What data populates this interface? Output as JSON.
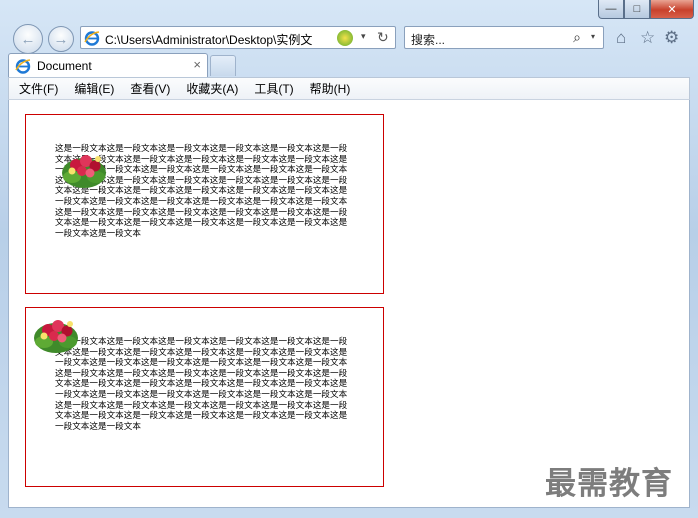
{
  "window": {
    "minimize_glyph": "—",
    "maximize_glyph": "□",
    "close_glyph": "✕"
  },
  "nav": {
    "back_glyph": "←",
    "forward_glyph": "→",
    "address": "C:\\Users\\Administrator\\Desktop\\实例文",
    "refresh_glyph": "↻",
    "dropdown_glyph": "▾"
  },
  "search": {
    "placeholder": "搜索...",
    "icon_glyph": "⌕",
    "dropdown_glyph": "▾"
  },
  "toolbar": {
    "home_glyph": "⌂",
    "favorites_glyph": "☆",
    "settings_glyph": "⚙"
  },
  "tab": {
    "title": "Document",
    "close_glyph": "×"
  },
  "menu": {
    "items": [
      "文件(F)",
      "编辑(E)",
      "查看(V)",
      "收藏夹(A)",
      "工具(T)",
      "帮助(H)"
    ]
  },
  "content": {
    "box1_text": "这是一段文本这是一段文本这是一段文本这是一段文本这是一段文本这是一段文本这是一段文本这是一段文本这是一段文本这是一段文本这是一段文本这是一段文本这是一段文本这是一段文本这是一段文本这是一段文本这是一段文本这是一段文本这是一段文本这是一段文本这是一段文本这是一段文本这是一段文本这是一段文本这是一段文本这是一段文本这是一段文本这是一段文本这是一段文本这是一段文本这是一段文本这是一段文本这是一段文本这是一段文本这是一段文本这是一段文本这是一段文本这是一段文本这是一段文本这是一段文本这是一段文本这是一段文本这是一段文本这是一段文本这是一段文本这是一段文本这是一段文本",
    "box2_text": "这是一段文本这是一段文本这是一段文本这是一段文本这是一段文本这是一段文本这是一段文本这是一段文本这是一段文本这是一段文本这是一段文本这是一段文本这是一段文本这是一段文本这是一段文本这是一段文本这是一段文本这是一段文本这是一段文本这是一段文本这是一段文本这是一段文本这是一段文本这是一段文本这是一段文本这是一段文本这是一段文本这是一段文本这是一段文本这是一段文本这是一段文本这是一段文本这是一段文本这是一段文本这是一段文本这是一段文本这是一段文本这是一段文本这是一段文本这是一段文本这是一段文本这是一段文本这是一段文本这是一段文本这是一段文本这是一段文本这是一段文本"
  },
  "watermark": "最需教育",
  "colors": {
    "box_border": "#cc0000",
    "watermark": "#7d7d7d"
  }
}
